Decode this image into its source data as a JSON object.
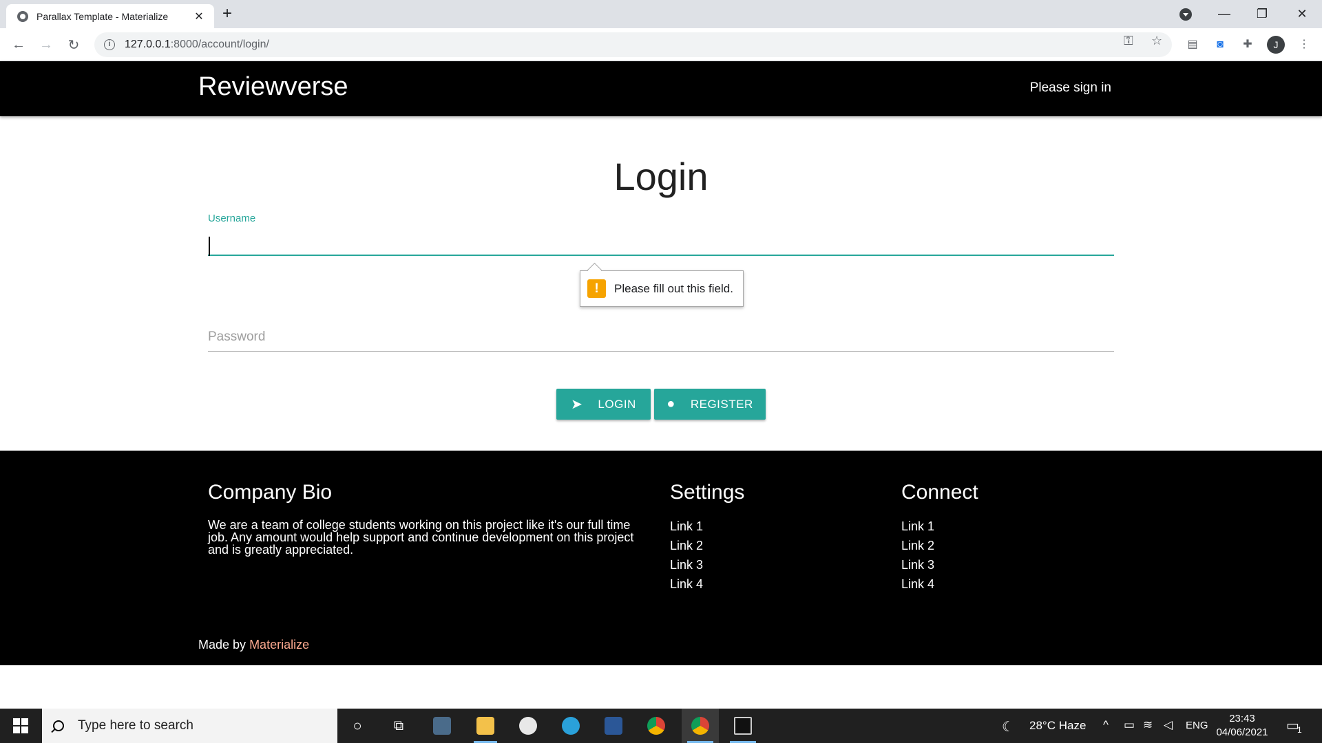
{
  "browser": {
    "tab_title": "Parallax Template - Materialize",
    "url_host": "127.0.0.1",
    "url_rest": ":8000/account/login/",
    "avatar_letter": "J"
  },
  "navbar": {
    "brand": "Reviewverse",
    "signin": "Please sign in"
  },
  "login": {
    "title": "Login",
    "username_label": "Username",
    "password_placeholder": "Password",
    "validation_message": "Please fill out this field.",
    "login_button": "LOGIN",
    "register_button": "REGISTER"
  },
  "footer": {
    "bio_title": "Company Bio",
    "bio_text": "We are a team of college students working on this project like it's our full time job. Any amount would help support and continue development on this project and is greatly appreciated.",
    "settings_title": "Settings",
    "settings_links": [
      "Link 1",
      "Link 2",
      "Link 3",
      "Link 4"
    ],
    "connect_title": "Connect",
    "connect_links": [
      "Link 1",
      "Link 2",
      "Link 3",
      "Link 4"
    ],
    "made_by_prefix": "Made by",
    "made_by_link": "Materialize"
  },
  "taskbar": {
    "search_placeholder": "Type here to search",
    "weather": "28°C  Haze",
    "language": "ENG",
    "time": "23:43",
    "date": "04/06/2021",
    "notification_count": "1"
  },
  "colors": {
    "accent": "#26a69a",
    "navbar_bg": "#000000",
    "footer_bg": "#000000",
    "warning": "#f6a300"
  }
}
